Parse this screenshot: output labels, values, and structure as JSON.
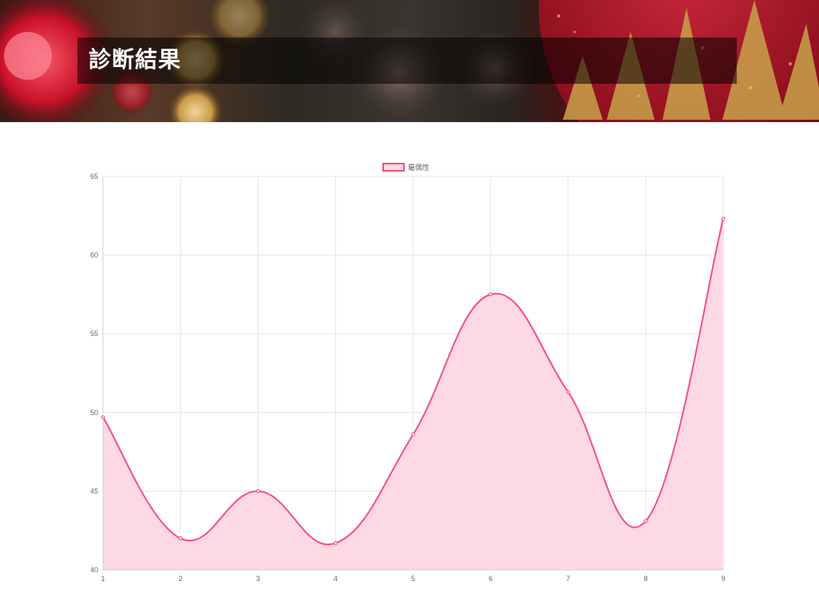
{
  "header": {
    "title": "診断結果"
  },
  "colors": {
    "line": "#f2517e",
    "fill": "#fdd9e3",
    "grid": "#e6e6e6",
    "tick_text": "#666666"
  },
  "chart_data": {
    "type": "line",
    "x": [
      1,
      2,
      3,
      4,
      5,
      6,
      7,
      8,
      9
    ],
    "categories": [
      "1",
      "2",
      "3",
      "4",
      "5",
      "6",
      "7",
      "8",
      "9"
    ],
    "series": [
      {
        "name": "屬偶性",
        "values": [
          49.7,
          42.0,
          45.0,
          41.7,
          48.6,
          57.5,
          51.3,
          43.1,
          62.3
        ],
        "fill": true,
        "smooth": true
      }
    ],
    "ylim": [
      40,
      65
    ],
    "yticks": [
      "40",
      "45",
      "50",
      "55",
      "60",
      "65"
    ],
    "grid": true,
    "legend_position": "top-center",
    "title": "",
    "xlabel": "",
    "ylabel": ""
  }
}
